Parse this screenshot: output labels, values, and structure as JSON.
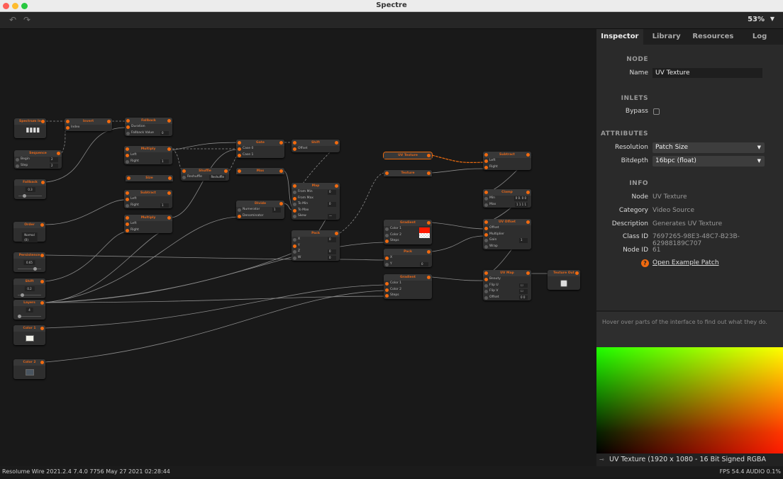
{
  "window": {
    "title": "Spectre"
  },
  "toolbar": {
    "undo_icon": "undo-icon",
    "redo_icon": "redo-icon",
    "zoom": "53%"
  },
  "nodes": [
    {
      "title": "Spectrum In",
      "kind": "wave"
    },
    {
      "title": "Invert",
      "rows": [
        {
          "label": "Index",
          "on": true
        }
      ]
    },
    {
      "title": "Fallback",
      "rows": [
        {
          "label": "Duration",
          "on": true
        },
        {
          "label": "Fallback Value",
          "value": "0"
        }
      ]
    },
    {
      "title": "Sequence",
      "noin": true,
      "rows": [
        {
          "label": "Begin",
          "value": "2"
        },
        {
          "label": "Step",
          "value": "2"
        }
      ]
    },
    {
      "title": "Fallback",
      "kind": "slider",
      "value": "0.3",
      "level": 0.2
    },
    {
      "title": "Multiply",
      "rows": [
        {
          "label": "Left",
          "on": true
        },
        {
          "label": "Right",
          "value": "1"
        }
      ]
    },
    {
      "title": "Size",
      "rows": []
    },
    {
      "title": "Subtract",
      "rows": [
        {
          "label": "Left",
          "on": true
        },
        {
          "label": "Right",
          "value": "1"
        }
      ]
    },
    {
      "title": "Multiply",
      "rows": [
        {
          "label": "Left",
          "on": true
        },
        {
          "label": "Right",
          "on": true
        }
      ]
    },
    {
      "title": "Order",
      "kind": "dropdown",
      "value": "Normal (0)"
    },
    {
      "title": "Shuffle",
      "rows": [
        {
          "label": "Reshuffle",
          "value": "Reshuffle"
        }
      ]
    },
    {
      "title": "Gate",
      "rows": [
        {
          "label": "Case 0",
          "on": true
        },
        {
          "label": "Case 1",
          "on": true
        }
      ]
    },
    {
      "title": "Shift",
      "rows": [
        {
          "label": "Offset",
          "on": true
        }
      ]
    },
    {
      "title": "Max",
      "rows": []
    },
    {
      "title": "Map",
      "rows": [
        {
          "label": "From Min",
          "value": "0"
        },
        {
          "label": "From Max",
          "on": true
        },
        {
          "label": "To Min",
          "value": "0"
        },
        {
          "label": "To Max",
          "on": true
        },
        {
          "label": "Skew",
          "value": "—"
        }
      ]
    },
    {
      "title": "Divide",
      "noin": true,
      "rows": [
        {
          "label": "Numerator",
          "value": "1"
        },
        {
          "label": "Denominator",
          "on": true
        }
      ]
    },
    {
      "title": "Pack",
      "noin": true,
      "rows": [
        {
          "label": "X",
          "value": "0"
        },
        {
          "label": "Y",
          "on": true
        },
        {
          "label": "Z",
          "value": "0"
        },
        {
          "label": "W",
          "value": "0"
        }
      ]
    },
    {
      "title": "UV Texture",
      "selected": true,
      "noin": true,
      "rows": []
    },
    {
      "title": "Texture",
      "rows": []
    },
    {
      "title": "Gradient",
      "noin": true,
      "swatches": [
        "#ff1a00",
        "checker"
      ],
      "rows": [
        {
          "label": "Color 1"
        },
        {
          "label": "Color 2"
        },
        {
          "label": "Steps",
          "on": true
        }
      ]
    },
    {
      "title": "Pack",
      "noin": true,
      "rows": [
        {
          "label": "X",
          "on": true
        },
        {
          "label": "Y",
          "value": "0"
        }
      ]
    },
    {
      "title": "Gradient",
      "noin": true,
      "rows": [
        {
          "label": "Color 1",
          "on": true
        },
        {
          "label": "Color 2",
          "on": true
        },
        {
          "label": "Steps",
          "on": true
        }
      ]
    },
    {
      "title": "Subtract",
      "rows": [
        {
          "label": "Left",
          "on": true
        },
        {
          "label": "Right",
          "on": true
        }
      ]
    },
    {
      "title": "Clamp",
      "rows": [
        {
          "label": "Min",
          "value": "0  0.  0  0"
        },
        {
          "label": "Max",
          "value": "1  1  1  1"
        }
      ]
    },
    {
      "title": "UV Offset",
      "rows": [
        {
          "label": "Offset",
          "on": true
        },
        {
          "label": "Multiplier",
          "on": true
        },
        {
          "label": "Gain",
          "value": "1"
        },
        {
          "label": "Wrap"
        }
      ]
    },
    {
      "title": "UV Map",
      "rows": [
        {
          "label": "Beauty",
          "on": true
        },
        {
          "label": "Flip U",
          "value": "☐"
        },
        {
          "label": "Flip V",
          "value": "☐"
        },
        {
          "label": "Offset",
          "value": "0     0"
        }
      ]
    },
    {
      "title": "Texture Out",
      "kind": "texout"
    },
    {
      "title": "Persistence",
      "kind": "slider",
      "value": "0.65",
      "level": 0.75
    },
    {
      "title": "Shift",
      "kind": "slider",
      "value": "0.2",
      "level": 0.15
    },
    {
      "title": "Layers",
      "kind": "slider",
      "value": "4",
      "level": 0.0
    },
    {
      "title": "Color 1",
      "kind": "swatch",
      "color": "#f2f2ea"
    },
    {
      "title": "Color 2",
      "kind": "swatch",
      "color": "#4a5560"
    }
  ],
  "inspector": {
    "tabs": [
      "Inspector",
      "Library",
      "Resources",
      "Log"
    ],
    "node_heading": "NODE",
    "name_label": "Name",
    "name_value": "UV Texture",
    "inlets_heading": "INLETS",
    "bypass_label": "Bypass",
    "attributes_heading": "ATTRIBUTES",
    "resolution_label": "Resolution",
    "resolution_value": "Patch Size",
    "bitdepth_label": "Bitdepth",
    "bitdepth_value": "16bpc (float)",
    "info_heading": "INFO",
    "info": [
      {
        "label": "Node",
        "value": "UV Texture"
      },
      {
        "label": "Category",
        "value": "Video Source"
      },
      {
        "label": "Description",
        "value": "Generates UV Texture"
      },
      {
        "label": "Class ID",
        "value": "7697265-98E3-48C7-B23B-62988189C707"
      },
      {
        "label": "Node ID",
        "value": "61"
      }
    ],
    "example_link": "Open Example Patch",
    "hint": "Hover over parts of the interface to find out what they do.",
    "preview_caption": "UV Texture (1920 x 1080 - 16 Bit Signed RGBA (float))"
  },
  "status": {
    "left": "Resolume Wire 2021.2.4 7.4.0 7756 May 27 2021 02:28:44",
    "right": "FPS 54.4   AUDIO 0.1%"
  },
  "colors": {
    "accent": "#f06a10",
    "canvas": "#191919",
    "panel": "#2a2a2a"
  }
}
